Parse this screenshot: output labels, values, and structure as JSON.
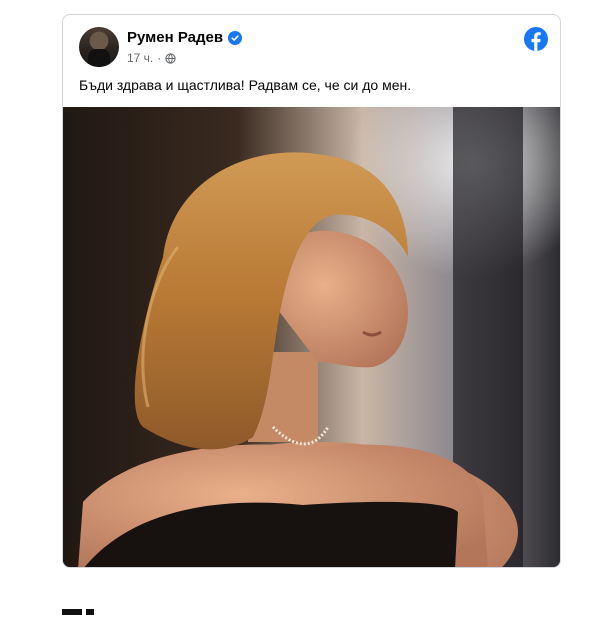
{
  "post": {
    "author_name": "Румен Радев",
    "timestamp": "17 ч.",
    "separator": "·",
    "text": "Бъди здрава и щастлива! Радвам се, че си до мен.",
    "icons": {
      "verified": "verified-badge-icon",
      "audience": "globe-icon",
      "brand": "facebook-logo-icon"
    }
  },
  "colors": {
    "brand_blue": "#1877f2",
    "text_primary": "#050505",
    "text_secondary": "#65676b"
  }
}
